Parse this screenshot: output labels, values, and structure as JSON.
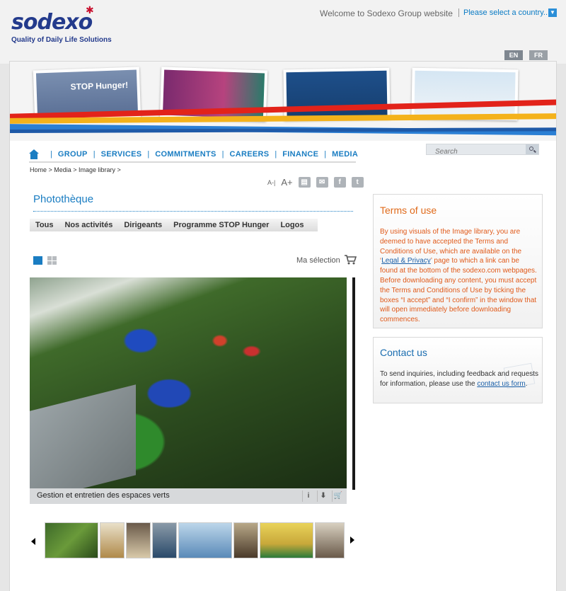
{
  "header": {
    "logo_text": "sodexo",
    "tagline": "Quality of Daily Life Solutions",
    "welcome": "Welcome to Sodexo Group website",
    "country_select": "Please select a country...",
    "languages": [
      "EN",
      "FR"
    ]
  },
  "banner": {
    "card1_text": "STOP Hunger!"
  },
  "nav": {
    "items": [
      "GROUP",
      "SERVICES",
      "COMMITMENTS",
      "CAREERS",
      "FINANCE",
      "MEDIA"
    ]
  },
  "search": {
    "placeholder": "Search"
  },
  "breadcrumb": "Home >  Media >  Image library >",
  "tools": {
    "font_smaller": "A-|",
    "font_larger": "A+"
  },
  "phototheque": {
    "title": "Photothèque",
    "tabs": [
      "Tous",
      "Nos activités",
      "Dirigeants",
      "Programme STOP Hunger",
      "Logos"
    ],
    "selection_label": "Ma sélection",
    "caption": "Gestion et entretien des espaces verts",
    "caption_info": "i",
    "caption_download": "⬇",
    "caption_cart": "🛒"
  },
  "terms": {
    "title": "Terms of use",
    "text_before": "By using visuals of the Image library, you are deemed to have accepted the Terms and Conditions of Use, which are available on the ‘",
    "link": "Legal & Privacy",
    "text_after": "’ page to which a link can be found at the bottom of the sodexo.com webpages. Before downloading any content, you must accept the Terms and Conditions of Use by ticking the boxes “I accept” and “I confirm” in the window that will open immediately before downloading commences."
  },
  "contact": {
    "title": "Contact us",
    "text": "To send inquiries, including feedback and requests for information, please use the ",
    "link": "contact us form",
    "text_end": "."
  },
  "colors": {
    "brand_blue": "#1a7dc2",
    "logo_blue": "#233a8c",
    "terms_orange": "#e06a1a"
  }
}
